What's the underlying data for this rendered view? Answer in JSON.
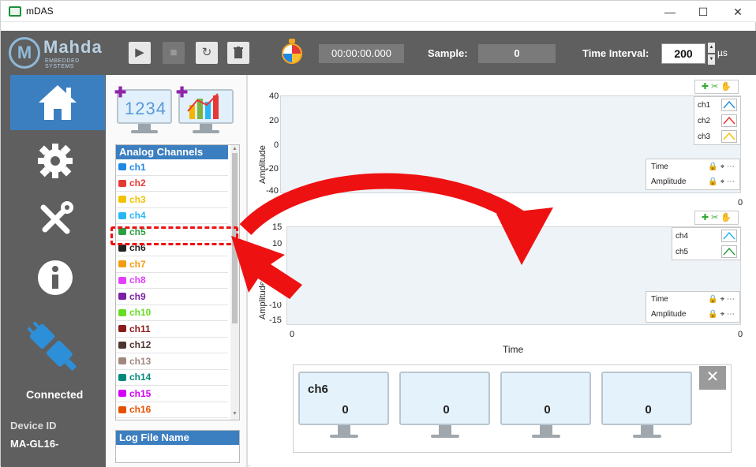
{
  "window": {
    "title": "mDAS",
    "minimize": "—",
    "maximize": "☐",
    "close": "✕"
  },
  "brand": {
    "logo_letter": "M",
    "name": "Mahda",
    "subtitle": "EMBEDDED SYSTEMS"
  },
  "toolbar": {
    "play_icon": "▶",
    "save_icon": "■",
    "reset_icon": "↻",
    "trash_icon": "🗑",
    "timer": "00:00:00.000",
    "sample_label": "Sample:",
    "sample_value": "0",
    "time_interval_label": "Time Interval:",
    "time_interval_value": "200",
    "time_interval_unit": "µs"
  },
  "sidenav": {
    "items": [
      "home",
      "settings",
      "tools",
      "info"
    ],
    "status": "Connected",
    "device_id_label": "Device ID",
    "device_id_value": "MA-GL16-"
  },
  "panel": {
    "digits_icon_text": "1234",
    "channels_header": "Analog Channels",
    "channels": [
      {
        "label": "ch1",
        "color": "#1e88e5"
      },
      {
        "label": "ch2",
        "color": "#e53935"
      },
      {
        "label": "ch3",
        "color": "#f2c200"
      },
      {
        "label": "ch4",
        "color": "#29b6f6"
      },
      {
        "label": "ch5",
        "color": "#2e9e44"
      },
      {
        "label": "ch6",
        "color": "#222222"
      },
      {
        "label": "ch7",
        "color": "#f39c12"
      },
      {
        "label": "ch8",
        "color": "#e040fb"
      },
      {
        "label": "ch9",
        "color": "#7b1fa2"
      },
      {
        "label": "ch10",
        "color": "#66dd22"
      },
      {
        "label": "ch11",
        "color": "#8b1a1a"
      },
      {
        "label": "ch12",
        "color": "#4e342e"
      },
      {
        "label": "ch13",
        "color": "#a1887f"
      },
      {
        "label": "ch14",
        "color": "#00897b"
      },
      {
        "label": "ch15",
        "color": "#d500f9"
      },
      {
        "label": "ch16",
        "color": "#e65100"
      }
    ],
    "log_header": "Log File Name"
  },
  "charts": [
    {
      "ylabel": "Amplitude",
      "yticks": [
        "40",
        "20",
        "0",
        "-20",
        "-40"
      ],
      "xticks": [
        "0",
        "0"
      ],
      "xlabel": "Time",
      "legend": [
        {
          "label": "ch1",
          "color": "#2a8fd8"
        },
        {
          "label": "ch2",
          "color": "#e53935"
        },
        {
          "label": "ch3",
          "color": "#f2c200"
        }
      ],
      "cursor_rows": [
        "Time",
        "Amplitude"
      ]
    },
    {
      "ylabel": "Amplitude",
      "yticks": [
        "15",
        "10",
        "0",
        "-10",
        "-15"
      ],
      "xticks": [
        "0",
        "0"
      ],
      "xlabel": "Time",
      "legend": [
        {
          "label": "ch4",
          "color": "#29b6f6"
        },
        {
          "label": "ch5",
          "color": "#2e9e44"
        }
      ],
      "cursor_rows": [
        "Time",
        "Amplitude"
      ]
    }
  ],
  "numeric_displays": [
    {
      "channel": "ch6",
      "value": "0"
    },
    {
      "channel": "",
      "value": "0"
    },
    {
      "channel": "",
      "value": "0"
    },
    {
      "channel": "",
      "value": "0"
    }
  ],
  "numeric_close": "✕",
  "chart_tools_icons": "✚ ✂ ✋",
  "cursor_tools_icons": "🔒 ⌖ ⋯"
}
